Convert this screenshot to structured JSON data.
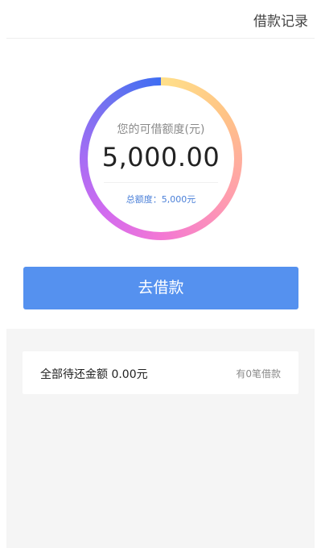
{
  "header": {
    "loan_records_label": "借款记录"
  },
  "quota": {
    "label": "您的可借额度(元)",
    "amount": "5,000.00",
    "total_line": "总额度：5,000元"
  },
  "actions": {
    "borrow_label": "去借款"
  },
  "repayment": {
    "label": "全部待还金额 0.00元",
    "loan_count": "有0笔借款"
  },
  "colors": {
    "primary_button": "#5591ef",
    "total_text": "#4a7fd8",
    "section_background": "#f5f5f5"
  }
}
